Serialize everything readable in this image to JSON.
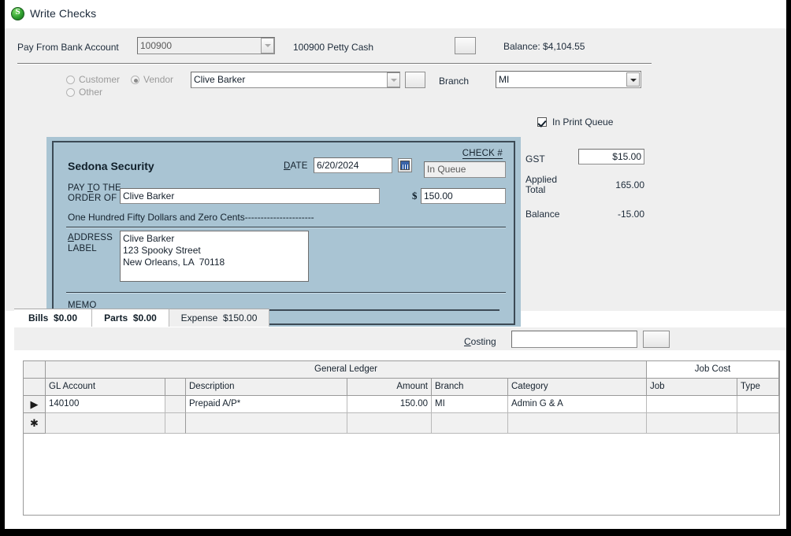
{
  "window": {
    "title": "Write Checks",
    "icon": "sedona-s-icon"
  },
  "header": {
    "pay_from_label": "Pay From Bank Account",
    "bank_account_value": "100900",
    "bank_account_name": "100900 Petty Cash",
    "lookup_button": "",
    "balance_label": "Balance: $4,104.55"
  },
  "payee": {
    "customer_label": "Customer",
    "vendor_label": "Vendor",
    "other_label": "Other",
    "selected": "Vendor",
    "name_value": "Clive Barker",
    "lookup_button": "",
    "branch_label": "Branch",
    "branch_value": "MI"
  },
  "check": {
    "company": "Sedona Security",
    "date_label": "DATE",
    "date_value": "6/20/2024",
    "calendar_icon": "calendar-icon",
    "check_number_label": "CHECK #",
    "check_number_value": "In Queue",
    "pay_to_line1": "PAY TO THE",
    "pay_to_line2": "ORDER OF",
    "payee_value": "Clive Barker",
    "currency_symbol": "$",
    "amount_value": "150.00",
    "amount_words": "One Hundred Fifty Dollars and Zero Cents----------------------",
    "address_label_line1": "ADDRESS",
    "address_label_line2": "LABEL",
    "address_value": "Clive Barker\n123 Spooky Street\nNew Orleans, LA  70118",
    "memo_label": "MEMO",
    "memo_value": ""
  },
  "summary": {
    "in_print_queue_label": "In Print Queue",
    "in_print_queue_checked": true,
    "gst_label": "GST",
    "gst_value": "$15.00",
    "applied_total_label_line1": "Applied",
    "applied_total_label_line2": "Total",
    "applied_total_value": "165.00",
    "balance_label": "Balance",
    "balance_value": "-15.00"
  },
  "tabs": [
    {
      "label": "Bills",
      "amount": "$0.00",
      "active": false
    },
    {
      "label": "Parts",
      "amount": "$0.00",
      "active": false
    },
    {
      "label": "Expense",
      "amount": "$150.00",
      "active": true
    }
  ],
  "costing": {
    "label": "Costing",
    "value": "",
    "placeholder": "",
    "lookup_button": ""
  },
  "grid": {
    "band_general_ledger": "General Ledger",
    "band_job_cost": "Job Cost",
    "columns": [
      "GL Account",
      "",
      "Description",
      "Amount",
      "Branch",
      "Category",
      "Job",
      "Type"
    ],
    "rows": [
      {
        "selector": "▶",
        "gl_account": "140100",
        "spacer": "",
        "description": "Prepaid A/P*",
        "amount": "150.00",
        "branch": "MI",
        "category": "Admin G & A",
        "job": "",
        "type": ""
      },
      {
        "selector": "✱",
        "gl_account": "",
        "spacer": "",
        "description": "",
        "amount": "",
        "branch": "",
        "category": "",
        "job": "",
        "type": ""
      }
    ]
  },
  "colors": {
    "check_bg": "#a9c4d3",
    "panel_bg": "#efefef",
    "text": "#1d2b3a",
    "accent_green": "#2f9e2f"
  }
}
